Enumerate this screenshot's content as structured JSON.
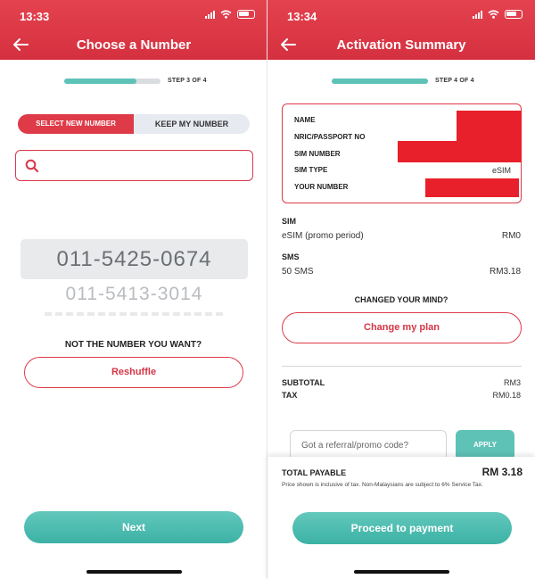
{
  "left": {
    "status_time": "13:33",
    "title": "Choose a Number",
    "step": "STEP 3 OF 4",
    "step_progress": 0.75,
    "toggle": {
      "active": "SELECT NEW NUMBER",
      "inactive": "KEEP MY NUMBER"
    },
    "search": {
      "placeholder": ""
    },
    "numbers": [
      "011-5425-0674",
      "011-5413-3014"
    ],
    "not_number": "NOT THE NUMBER YOU WANT?",
    "reshuffle": "Reshuffle",
    "next": "Next"
  },
  "right": {
    "status_time": "13:34",
    "title": "Activation Summary",
    "step": "STEP 4 OF 4",
    "step_progress": 1.0,
    "info_labels": [
      "NAME",
      "NRIC/PASSPORT NO",
      "SIM NUMBER",
      "SIM TYPE",
      "YOUR NUMBER"
    ],
    "sim_type_value": "eSIM",
    "sim": {
      "title": "SIM",
      "item": "eSIM (promo period)",
      "price": "RM0"
    },
    "sms": {
      "title": "SMS",
      "item": "50 SMS",
      "price": "RM3.18"
    },
    "changed_mind": "CHANGED YOUR MIND?",
    "change_plan": "Change my plan",
    "subtotal": {
      "label": "SUBTOTAL",
      "value": "RM3"
    },
    "tax": {
      "label": "TAX",
      "value": "RM0.18"
    },
    "promo_placeholder": "Got a referral/promo code?",
    "apply": "APPLY",
    "total": {
      "label": "TOTAL PAYABLE",
      "value": "RM 3.18"
    },
    "disclaimer": "Price shown is inclusive of tax. Non-Malaysians are subject to 6% Service Tax.",
    "proceed": "Proceed to payment"
  },
  "colors": {
    "brand_red": "#de3a48",
    "teal": "#5fc2b7",
    "redaction": "#e8202b"
  }
}
